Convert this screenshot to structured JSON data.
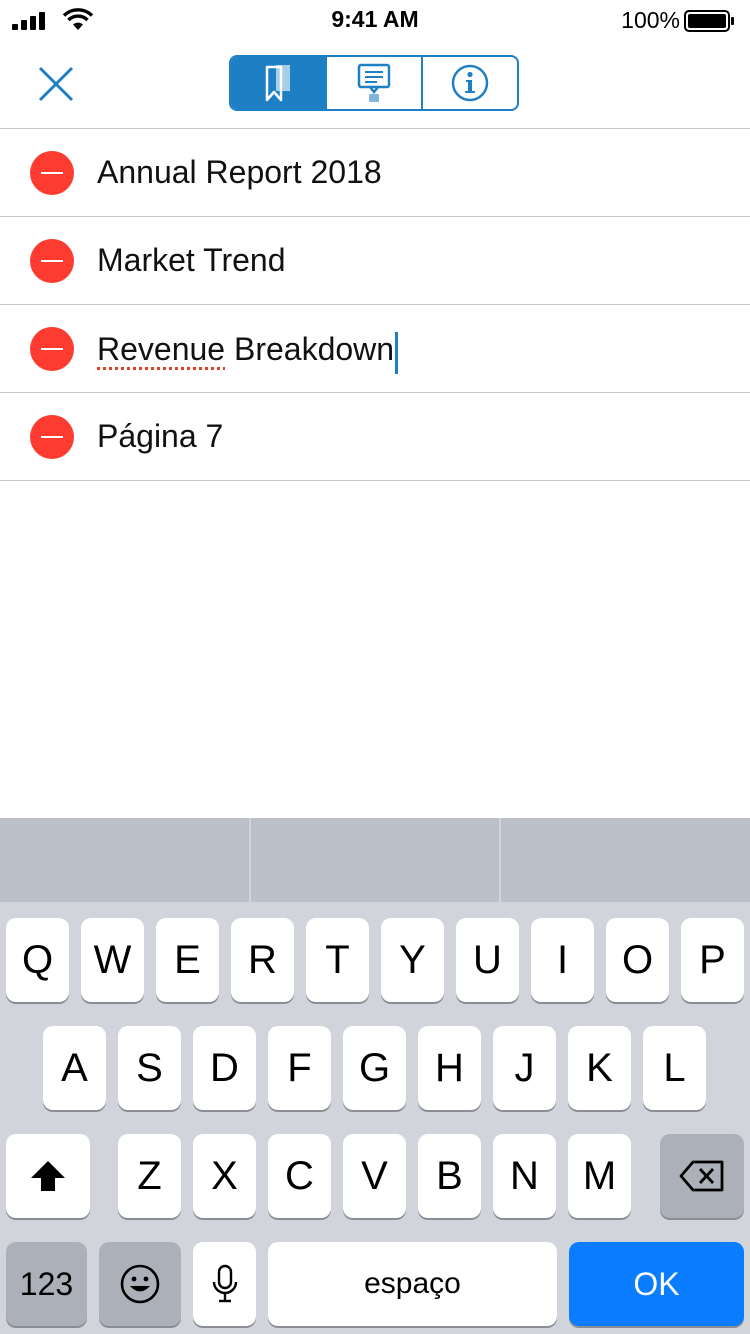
{
  "status_bar": {
    "time": "9:41 AM",
    "battery_text": "100%"
  },
  "nav": {
    "close_icon": "close-icon",
    "segments": [
      {
        "icon": "bookmark-icon",
        "active": true
      },
      {
        "icon": "comment-icon",
        "active": false
      },
      {
        "icon": "info-icon",
        "active": false
      }
    ]
  },
  "list": {
    "items": [
      {
        "label": "Annual Report 2018"
      },
      {
        "label": "Market Trend"
      },
      {
        "label_part1": "Revenue",
        "label_part2": " Breakdown"
      },
      {
        "label": "Página 7"
      }
    ]
  },
  "keyboard": {
    "row1": [
      "Q",
      "W",
      "E",
      "R",
      "T",
      "Y",
      "U",
      "I",
      "O",
      "P"
    ],
    "row2": [
      "A",
      "S",
      "D",
      "F",
      "G",
      "H",
      "J",
      "K",
      "L"
    ],
    "row3": [
      "Z",
      "X",
      "C",
      "V",
      "B",
      "N",
      "M"
    ],
    "numbers_key": "123",
    "space_key": "espaço",
    "return_key": "OK"
  },
  "colors": {
    "accent": "#1e7fc4",
    "delete": "#fd3b30",
    "return_key": "#0a7cff"
  }
}
